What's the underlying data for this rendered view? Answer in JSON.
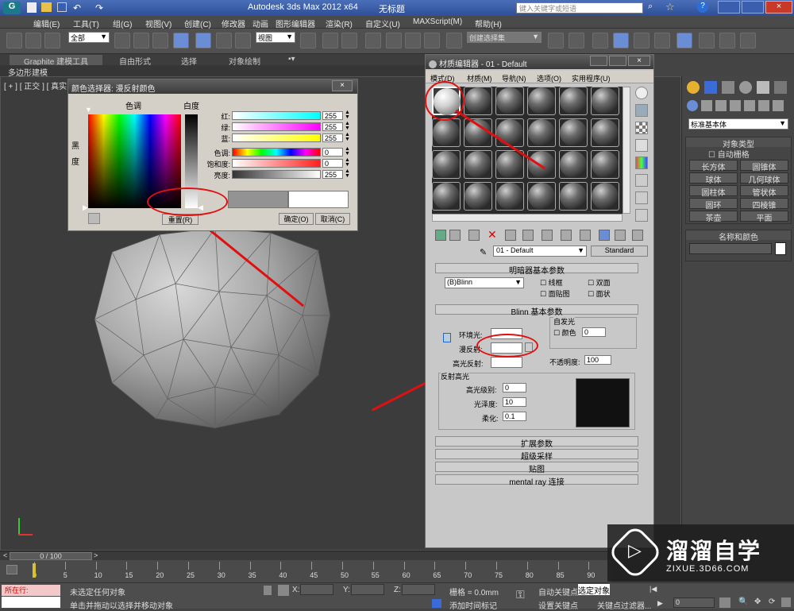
{
  "app_title": "Autodesk 3ds Max  2012 x64",
  "doc_title": "无标题",
  "search_placeholder": "键入关键字或短语",
  "menu": [
    "编辑(E)",
    "工具(T)",
    "组(G)",
    "视图(V)",
    "创建(C)",
    "修改器",
    "动画",
    "图形编辑器",
    "渲染(R)",
    "自定义(U)",
    "MAXScript(M)",
    "帮助(H)"
  ],
  "toolbar": {
    "selection_filter": "全部",
    "view_dropdown": "视图",
    "named_sel": "创建选择集"
  },
  "ribbon": {
    "tabs": [
      "Graphite 建模工具",
      "自由形式",
      "选择",
      "对象绘制"
    ],
    "sub": "多边形建模"
  },
  "viewport_label": "[ + ] [ 正交 ] [ 真实 ]",
  "color_picker": {
    "title": "颜色选择器: 漫反射颜色",
    "hue_label": "色调",
    "white_label": "白度",
    "black_label": "黑度",
    "rows": [
      {
        "label": "红:",
        "value": "255",
        "color": "#00ffff"
      },
      {
        "label": "绿:",
        "value": "255",
        "color": "#ff00ff"
      },
      {
        "label": "蓝:",
        "value": "255",
        "color": "#ffff00"
      },
      {
        "label": "色调:",
        "value": "0",
        "color": "rainbow"
      },
      {
        "label": "饱和度:",
        "value": "0",
        "color": "#ff2020"
      },
      {
        "label": "亮度:",
        "value": "255",
        "color": "#ffffff"
      }
    ],
    "reset": "重置(R)",
    "ok": "确定(O)",
    "cancel": "取消(C)"
  },
  "mat_editor": {
    "title": "材质编辑器 - 01 - Default",
    "menu": [
      "模式(D)",
      "材质(M)",
      "导航(N)",
      "选项(O)",
      "实用程序(U)"
    ],
    "mat_name": "01 - Default",
    "mat_type": "Standard",
    "shader_roll": "明暗器基本参数",
    "shader": "(B)Blinn",
    "checks": [
      "线框",
      "双面",
      "面贴图",
      "面状"
    ],
    "blinn_roll": "Blinn 基本参数",
    "self_illum": "自发光",
    "color_label": "颜色",
    "color_val": "0",
    "ambient": "环境光:",
    "diffuse": "漫反射:",
    "specular": "高光反射:",
    "opacity": "不透明度:",
    "opacity_val": "100",
    "spec_hl": "反射高光",
    "spec_level": "高光级别:",
    "spec_level_val": "0",
    "gloss": "光泽度:",
    "gloss_val": "10",
    "soften": "柔化:",
    "soften_val": "0.1",
    "rollouts": [
      "扩展参数",
      "超级采样",
      "贴图",
      "mental ray 连接"
    ]
  },
  "cmd_panel": {
    "category": "标准基本体",
    "object_type": "对象类型",
    "autogrid": "自动栅格",
    "buttons": [
      "长方体",
      "圆锥体",
      "球体",
      "几何球体",
      "圆柱体",
      "管状体",
      "圆环",
      "四棱锥",
      "茶壶",
      "平面"
    ],
    "name_color": "名称和颜色"
  },
  "timeline": {
    "frame": "0 / 100",
    "ticks": [
      "0",
      "5",
      "10",
      "15",
      "20",
      "25",
      "30",
      "35",
      "40",
      "45",
      "50",
      "55",
      "60",
      "65",
      "70",
      "75",
      "80",
      "85",
      "90"
    ]
  },
  "status": {
    "running": "所在行:",
    "msg1": "未选定任何对象",
    "msg2": "单击并拖动以选择并移动对象",
    "x": "X:",
    "y": "Y:",
    "z": "Z:",
    "grid": "栅格 = 0.0mm",
    "auto_key": "自动关键点",
    "sel_dropdown": "选定对象",
    "set_key": "设置关键点",
    "key_filter": "关键点过滤器...",
    "add_time": "添加时间标记",
    "frame_field": "0"
  },
  "watermark": {
    "brand": "溜溜自学",
    "url": "ZIXUE.3D66.COM"
  }
}
